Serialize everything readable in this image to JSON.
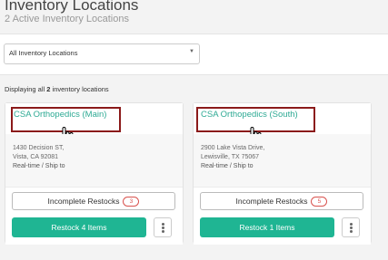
{
  "page": {
    "title": "Inventory Locations",
    "subtitle": "2 Active Inventory Locations"
  },
  "filter": {
    "selected": "All Inventory Locations"
  },
  "summary": {
    "prefix": "Displaying all",
    "count": "2",
    "suffix": "inventory locations"
  },
  "locations": [
    {
      "name": "CSA Orthopedics (Main)",
      "address_line1": "1430 Decision ST,",
      "address_line2": "Vista, CA 92081",
      "mode": "Real-time / Ship to",
      "incomplete_label": "Incomplete Restocks",
      "incomplete_count": "3",
      "restock_label": "Restock 4 Items"
    },
    {
      "name": "CSA Orthopedics (South)",
      "address_line1": "2900 Lake Vista Drive,",
      "address_line2": "Lewisville, TX 75067",
      "mode": "Real-time / Ship to",
      "incomplete_label": "Incomplete Restocks",
      "incomplete_count": "5",
      "restock_label": "Restock 1 Items"
    }
  ],
  "colors": {
    "accent": "#1fb593",
    "link": "#2eaa94",
    "highlight_border": "#8b1a1a",
    "badge": "#d9534f"
  }
}
